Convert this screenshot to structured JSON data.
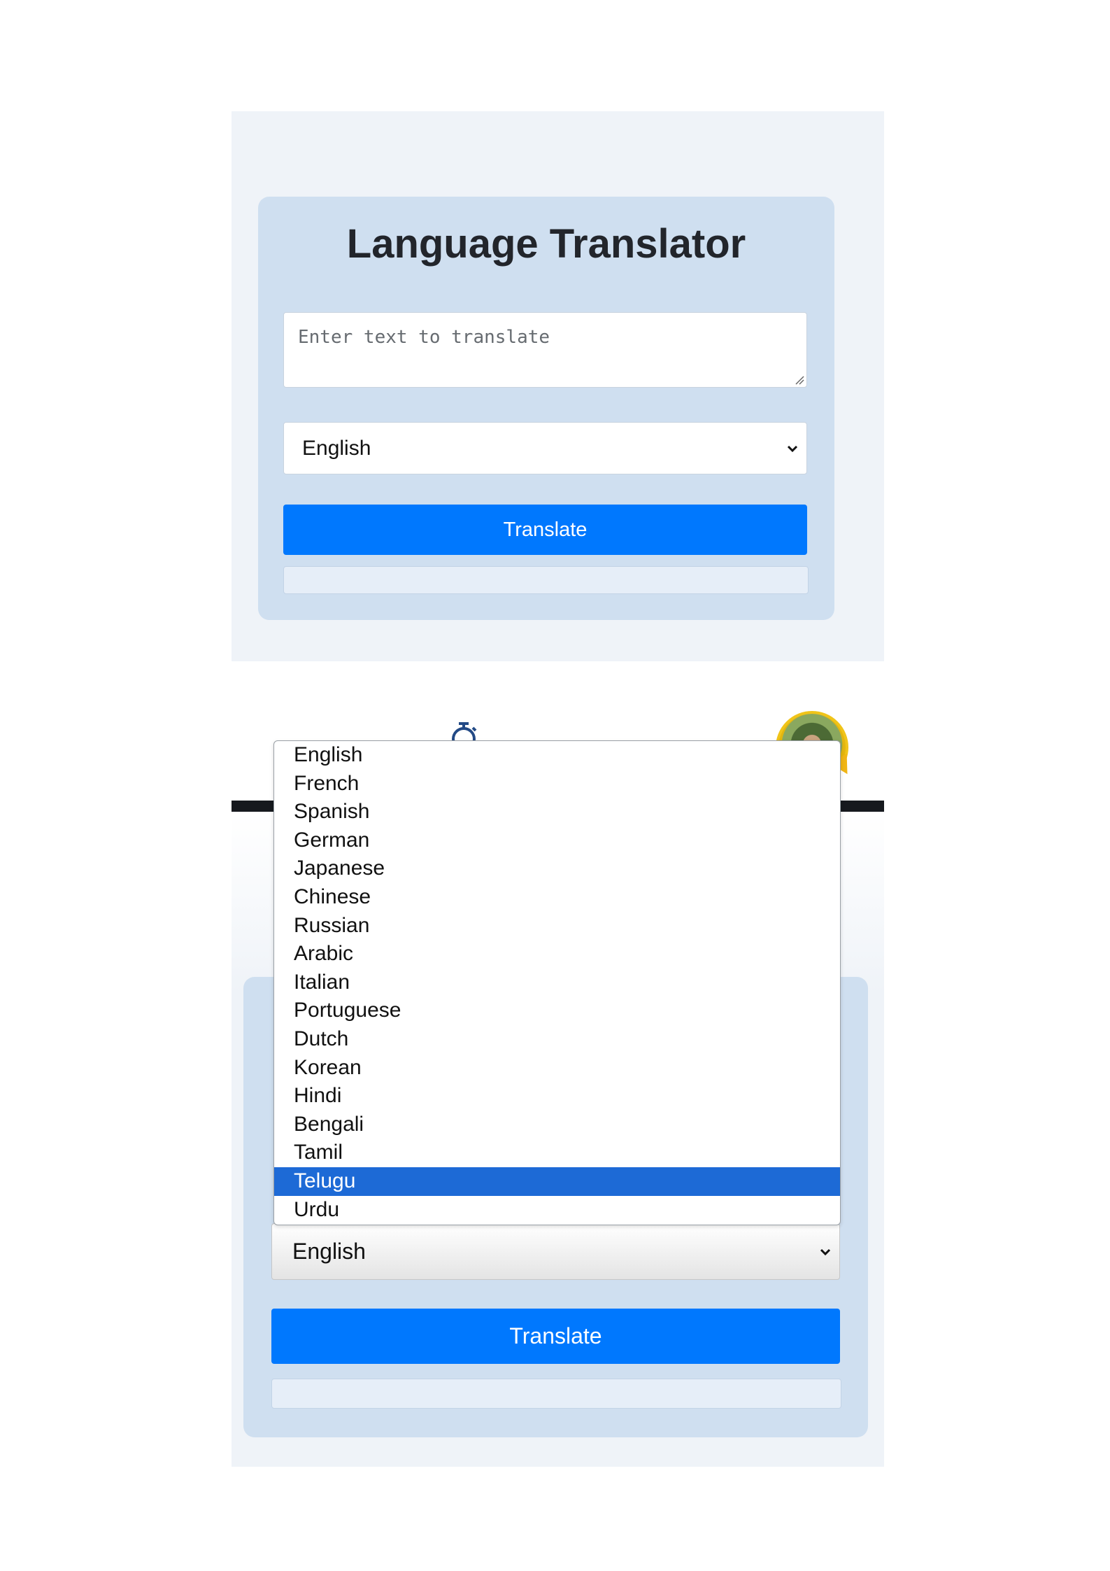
{
  "screens": [
    {
      "title": "Language Translator",
      "input": {
        "placeholder": "Enter text to translate",
        "value": ""
      },
      "language_select": {
        "selected": "English"
      },
      "translate_button": {
        "label": "Translate"
      },
      "output": {
        "text": ""
      }
    },
    {
      "language_select": {
        "selected": "English",
        "highlighted": "Telugu"
      },
      "translate_button": {
        "label": "Translate"
      },
      "output": {
        "text": ""
      },
      "dropdown_options": [
        "English",
        "French",
        "Spanish",
        "German",
        "Japanese",
        "Chinese",
        "Russian",
        "Arabic",
        "Italian",
        "Portuguese",
        "Dutch",
        "Korean",
        "Hindi",
        "Bengali",
        "Tamil",
        "Telugu",
        "Urdu"
      ],
      "header": {
        "icon": "timer-icon",
        "avatar": "avatar"
      }
    }
  ],
  "colors": {
    "page_background": "#eff3f8",
    "card": "#cfdff0",
    "button": "#0078fe",
    "highlight": "#1d6ad6",
    "dark_bar": "#16191e"
  }
}
